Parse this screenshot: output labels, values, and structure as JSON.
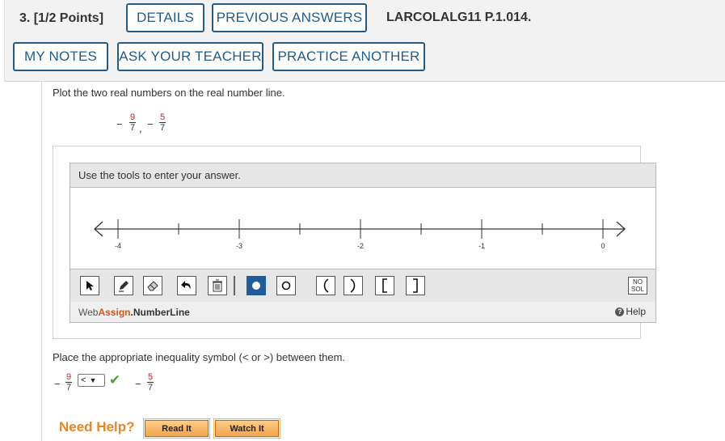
{
  "header": {
    "question_label": "3.  [1/2 Points]",
    "details_label": "DETAILS",
    "previous_answers_label": "PREVIOUS ANSWERS",
    "question_id": "LARCOLALG11 P.1.014.",
    "my_notes_label": "MY NOTES",
    "ask_teacher_label": "ASK YOUR TEACHER",
    "practice_another_label": "PRACTICE ANOTHER"
  },
  "problem": {
    "instruction": "Plot the two real numbers on the real number line.",
    "numbers": [
      {
        "sign": "−",
        "numerator": "9",
        "denominator": "7",
        "suffix": ","
      },
      {
        "sign": "−",
        "numerator": "5",
        "denominator": "7",
        "suffix": ""
      }
    ]
  },
  "widget": {
    "instruction": "Use the tools to enter your answer.",
    "tick_labels": [
      "-4",
      "-3",
      "-2",
      "-1",
      "0"
    ],
    "tools": [
      "pointer-icon",
      "pencil-icon",
      "eraser-icon",
      "undo-icon",
      "trash-icon",
      "closed-point-icon",
      "open-point-icon",
      "open-interval-icon",
      "closed-interval-icon"
    ],
    "nosol_label_1": "NO",
    "nosol_label_2": "SOL",
    "brand_web": "Web",
    "brand_assign": "Assign",
    "brand_product": ".NumberLine",
    "help_label": "Help"
  },
  "inequality": {
    "instruction": "Place the appropriate inequality symbol (< or >) between them.",
    "left": {
      "sign": "−",
      "numerator": "9",
      "denominator": "7"
    },
    "selected_symbol": "<",
    "right": {
      "sign": "−",
      "numerator": "5",
      "denominator": "7"
    }
  },
  "help": {
    "need_help_label": "Need Help?",
    "read_it_label": "Read It",
    "watch_it_label": "Watch It"
  },
  "colors": {
    "accent": "#245b87",
    "correct": "#4aa136",
    "help_orange": "#e8862a"
  }
}
